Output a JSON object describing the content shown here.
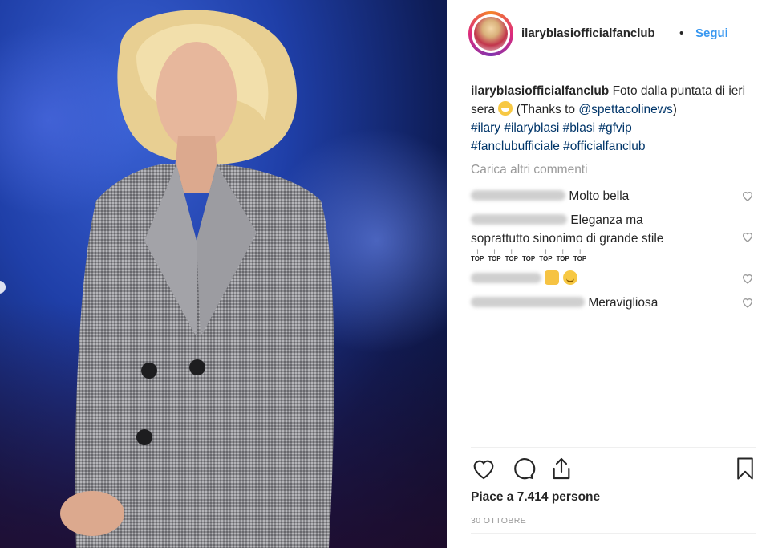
{
  "post": {
    "username": "ilaryblasiofficialfanclub",
    "separator_dot": "•",
    "follow_label": "Segui",
    "caption": {
      "username": "ilaryblasiofficialfanclub",
      "text_1": "Foto dalla puntata di ieri sera",
      "text_2": "(Thanks to",
      "mention": "@spettacolinews",
      "text_3": ")",
      "hashtags_line1": "#ilary #ilaryblasi #blasi #gfvip",
      "hashtags_line2": "#fanclubufficiale #officialfanclub"
    },
    "load_more_label": "Carica altri commenti",
    "comments": [
      {
        "text": "Molto bella"
      },
      {
        "text_1": "Eleganza ma",
        "text_2": "soprattutto sinonimo di grande stile",
        "emoji_label": "TOP"
      },
      {
        "text": ""
      },
      {
        "text": "Meravigliosa"
      }
    ],
    "likes_text": "Piace a 7.414 persone",
    "date": "30 OTTOBRE"
  },
  "icons": {
    "like": "heart-icon",
    "comment": "comment-icon",
    "share": "share-icon",
    "save": "bookmark-icon"
  },
  "colors": {
    "link": "#003569",
    "follow": "#3897f0",
    "muted": "#999999",
    "text": "#262626"
  }
}
